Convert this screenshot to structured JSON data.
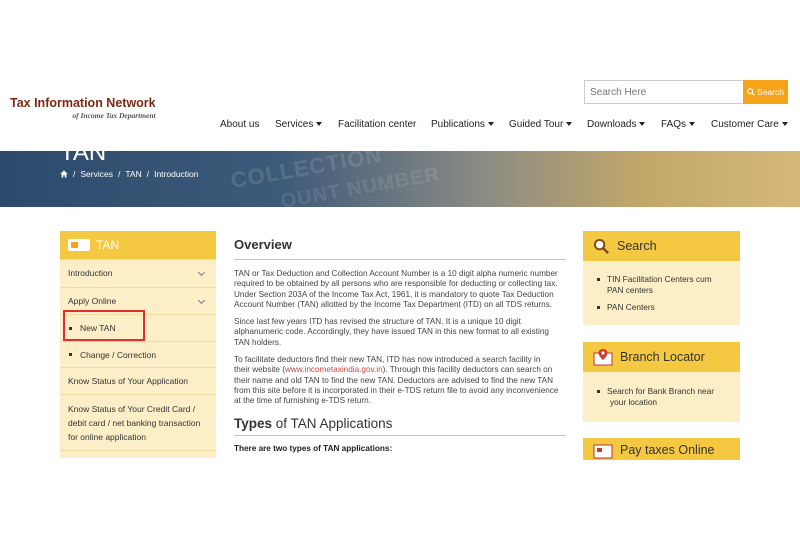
{
  "header": {
    "logo_title": "Tax Information Network",
    "logo_subtitle": "of Income Tax Department",
    "search_placeholder": "Search Here",
    "search_button": "Search",
    "brand_color": "#7a2a14",
    "accent_color": "#f5a31a"
  },
  "nav": {
    "items": [
      {
        "label": "About us",
        "dropdown": false
      },
      {
        "label": "Services",
        "dropdown": true
      },
      {
        "label": "Facilitation center",
        "dropdown": false
      },
      {
        "label": "Publications",
        "dropdown": true
      },
      {
        "label": "Guided Tour",
        "dropdown": true
      },
      {
        "label": "Downloads",
        "dropdown": true
      },
      {
        "label": "FAQs",
        "dropdown": true
      },
      {
        "label": "Customer Care",
        "dropdown": true
      }
    ]
  },
  "banner": {
    "title": "TAN",
    "texture_1": "COLLECTION",
    "texture_2": "OUNT NUMBER",
    "breadcrumb": [
      "Services",
      "TAN",
      "Introduction"
    ],
    "separator": "/"
  },
  "left_sidebar": {
    "title": "TAN",
    "items": [
      {
        "label": "Introduction"
      },
      {
        "label": "Apply Online"
      }
    ],
    "sub_items": [
      {
        "label": "New TAN"
      },
      {
        "label": "Change / Correction"
      }
    ],
    "links": [
      {
        "label": "Know Status of Your Application"
      },
      {
        "label_lines": [
          "Know Status of Your Credit Card /",
          "debit card / net banking transaction",
          "for online application"
        ]
      }
    ]
  },
  "main": {
    "overview_heading": "Overview",
    "para1_lines": [
      "TAN or Tax Deduction and Collection Account Number is a 10 digit alpha numeric number",
      "required to be obtained by all persons who are responsible for deducting or collecting tax.",
      "Under Section 203A of the Income Tax Act, 1961, it is mandatory to quote Tax Deduction",
      "Account Number (TAN) allotted by the Income Tax Department (ITD) on all TDS returns."
    ],
    "para2_lines": [
      "Since last few years ITD has revised the structure of TAN. It is a unique 10 digit",
      "alphanumeric code. Accordingly, they have issued TAN in this new format to all existing",
      "TAN holders."
    ],
    "para3_line1": "To facilitate deductors find their new TAN, ITD has now introduced a search facility in",
    "para3_line2_pre": "their website (",
    "para3_link": "www.incometaxindia.gov.in",
    "para3_line2_post": "). Through this facility deductors can search on",
    "para3_rest": [
      "their name and old TAN to find the new TAN. Deductors are advised to find the new TAN",
      "from this site before it is incorporated in their e-TDS return file to avoid any inconvenience",
      "at the time of furnishing e-TDS return."
    ],
    "types_heading_bold": "Types",
    "types_heading_rest": " of TAN Applications",
    "types_intro": "There are two types of TAN applications:"
  },
  "right_sidebar": {
    "search_box": {
      "title": "Search",
      "items": [
        {
          "lines": [
            "TIN Facilitation Centers cum",
            "PAN centers"
          ]
        },
        {
          "lines": [
            "PAN Centers"
          ]
        }
      ]
    },
    "branch_box": {
      "title": "Branch Locator",
      "items": [
        {
          "lines": [
            "Search for Bank Branch near",
            "your location"
          ]
        }
      ]
    },
    "pay_box": {
      "title": "Pay taxes Online"
    }
  }
}
